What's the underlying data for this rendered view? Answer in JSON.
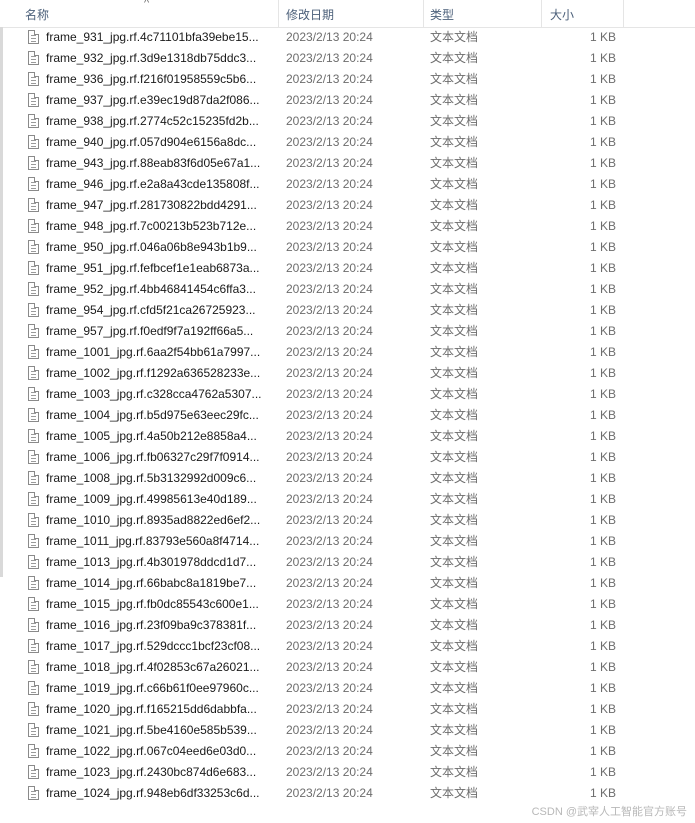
{
  "header": {
    "name": "名称",
    "date": "修改日期",
    "type": "类型",
    "size": "大小",
    "sort_indicator": "^"
  },
  "files": [
    {
      "name": "frame_931_jpg.rf.4c71101bfa39ebe15...",
      "date": "2023/2/13 20:24",
      "type": "文本文档",
      "size": "1 KB"
    },
    {
      "name": "frame_932_jpg.rf.3d9e1318db75ddc3...",
      "date": "2023/2/13 20:24",
      "type": "文本文档",
      "size": "1 KB"
    },
    {
      "name": "frame_936_jpg.rf.f216f01958559c5b6...",
      "date": "2023/2/13 20:24",
      "type": "文本文档",
      "size": "1 KB"
    },
    {
      "name": "frame_937_jpg.rf.e39ec19d87da2f086...",
      "date": "2023/2/13 20:24",
      "type": "文本文档",
      "size": "1 KB"
    },
    {
      "name": "frame_938_jpg.rf.2774c52c15235fd2b...",
      "date": "2023/2/13 20:24",
      "type": "文本文档",
      "size": "1 KB"
    },
    {
      "name": "frame_940_jpg.rf.057d904e6156a8dc...",
      "date": "2023/2/13 20:24",
      "type": "文本文档",
      "size": "1 KB"
    },
    {
      "name": "frame_943_jpg.rf.88eab83f6d05e67a1...",
      "date": "2023/2/13 20:24",
      "type": "文本文档",
      "size": "1 KB"
    },
    {
      "name": "frame_946_jpg.rf.e2a8a43cde135808f...",
      "date": "2023/2/13 20:24",
      "type": "文本文档",
      "size": "1 KB"
    },
    {
      "name": "frame_947_jpg.rf.281730822bdd4291...",
      "date": "2023/2/13 20:24",
      "type": "文本文档",
      "size": "1 KB"
    },
    {
      "name": "frame_948_jpg.rf.7c00213b523b712e...",
      "date": "2023/2/13 20:24",
      "type": "文本文档",
      "size": "1 KB"
    },
    {
      "name": "frame_950_jpg.rf.046a06b8e943b1b9...",
      "date": "2023/2/13 20:24",
      "type": "文本文档",
      "size": "1 KB"
    },
    {
      "name": "frame_951_jpg.rf.fefbcef1e1eab6873a...",
      "date": "2023/2/13 20:24",
      "type": "文本文档",
      "size": "1 KB"
    },
    {
      "name": "frame_952_jpg.rf.4bb46841454c6ffa3...",
      "date": "2023/2/13 20:24",
      "type": "文本文档",
      "size": "1 KB"
    },
    {
      "name": "frame_954_jpg.rf.cfd5f21ca26725923...",
      "date": "2023/2/13 20:24",
      "type": "文本文档",
      "size": "1 KB"
    },
    {
      "name": "frame_957_jpg.rf.f0edf9f7a192ff66a5...",
      "date": "2023/2/13 20:24",
      "type": "文本文档",
      "size": "1 KB"
    },
    {
      "name": "frame_1001_jpg.rf.6aa2f54bb61a7997...",
      "date": "2023/2/13 20:24",
      "type": "文本文档",
      "size": "1 KB"
    },
    {
      "name": "frame_1002_jpg.rf.f1292a636528233e...",
      "date": "2023/2/13 20:24",
      "type": "文本文档",
      "size": "1 KB"
    },
    {
      "name": "frame_1003_jpg.rf.c328cca4762a5307...",
      "date": "2023/2/13 20:24",
      "type": "文本文档",
      "size": "1 KB"
    },
    {
      "name": "frame_1004_jpg.rf.b5d975e63eec29fc...",
      "date": "2023/2/13 20:24",
      "type": "文本文档",
      "size": "1 KB"
    },
    {
      "name": "frame_1005_jpg.rf.4a50b212e8858a4...",
      "date": "2023/2/13 20:24",
      "type": "文本文档",
      "size": "1 KB"
    },
    {
      "name": "frame_1006_jpg.rf.fb06327c29f7f0914...",
      "date": "2023/2/13 20:24",
      "type": "文本文档",
      "size": "1 KB"
    },
    {
      "name": "frame_1008_jpg.rf.5b3132992d009c6...",
      "date": "2023/2/13 20:24",
      "type": "文本文档",
      "size": "1 KB"
    },
    {
      "name": "frame_1009_jpg.rf.49985613e40d189...",
      "date": "2023/2/13 20:24",
      "type": "文本文档",
      "size": "1 KB"
    },
    {
      "name": "frame_1010_jpg.rf.8935ad8822ed6ef2...",
      "date": "2023/2/13 20:24",
      "type": "文本文档",
      "size": "1 KB"
    },
    {
      "name": "frame_1011_jpg.rf.83793e560a8f4714...",
      "date": "2023/2/13 20:24",
      "type": "文本文档",
      "size": "1 KB"
    },
    {
      "name": "frame_1013_jpg.rf.4b301978ddcd1d7...",
      "date": "2023/2/13 20:24",
      "type": "文本文档",
      "size": "1 KB"
    },
    {
      "name": "frame_1014_jpg.rf.66babc8a1819be7...",
      "date": "2023/2/13 20:24",
      "type": "文本文档",
      "size": "1 KB"
    },
    {
      "name": "frame_1015_jpg.rf.fb0dc85543c600e1...",
      "date": "2023/2/13 20:24",
      "type": "文本文档",
      "size": "1 KB"
    },
    {
      "name": "frame_1016_jpg.rf.23f09ba9c378381f...",
      "date": "2023/2/13 20:24",
      "type": "文本文档",
      "size": "1 KB"
    },
    {
      "name": "frame_1017_jpg.rf.529dccc1bcf23cf08...",
      "date": "2023/2/13 20:24",
      "type": "文本文档",
      "size": "1 KB"
    },
    {
      "name": "frame_1018_jpg.rf.4f02853c67a26021...",
      "date": "2023/2/13 20:24",
      "type": "文本文档",
      "size": "1 KB"
    },
    {
      "name": "frame_1019_jpg.rf.c66b61f0ee97960c...",
      "date": "2023/2/13 20:24",
      "type": "文本文档",
      "size": "1 KB"
    },
    {
      "name": "frame_1020_jpg.rf.f165215dd6dabbfa...",
      "date": "2023/2/13 20:24",
      "type": "文本文档",
      "size": "1 KB"
    },
    {
      "name": "frame_1021_jpg.rf.5be4160e585b539...",
      "date": "2023/2/13 20:24",
      "type": "文本文档",
      "size": "1 KB"
    },
    {
      "name": "frame_1022_jpg.rf.067c04eed6e03d0...",
      "date": "2023/2/13 20:24",
      "type": "文本文档",
      "size": "1 KB"
    },
    {
      "name": "frame_1023_jpg.rf.2430bc874d6e683...",
      "date": "2023/2/13 20:24",
      "type": "文本文档",
      "size": "1 KB"
    },
    {
      "name": "frame_1024_jpg.rf.948eb6df33253c6d...",
      "date": "2023/2/13 20:24",
      "type": "文本文档",
      "size": "1 KB"
    }
  ],
  "file_icon": "text-file-icon",
  "watermark": "CSDN @武宰人工智能官方账号",
  "colors": {
    "header_text": "#4c607a",
    "name_text": "#1a1a1a",
    "meta_text": "#6d6d6d",
    "divider": "#e5e5e5"
  }
}
